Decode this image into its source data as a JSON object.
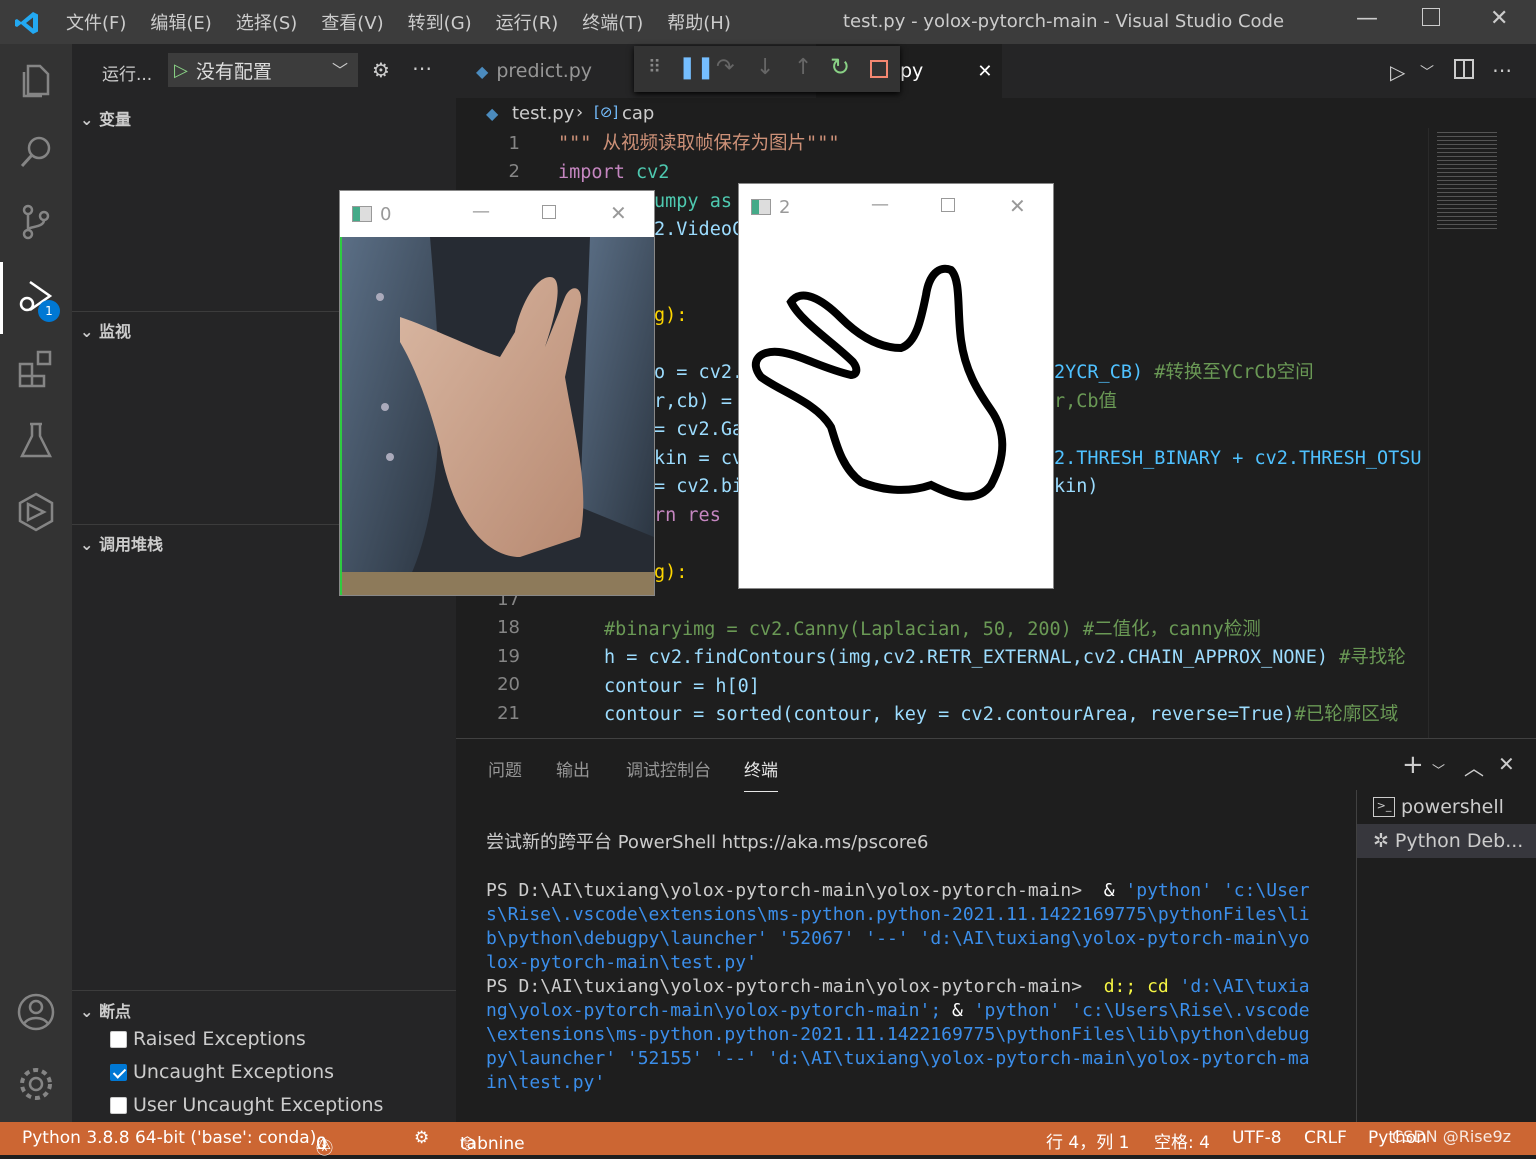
{
  "titlebar": {
    "menu": [
      "文件(F)",
      "编辑(E)",
      "选择(S)",
      "查看(V)",
      "转到(G)",
      "运行(R)",
      "终端(T)",
      "帮助(H)"
    ],
    "title": "test.py - yolox-pytorch-main - Visual Studio Code"
  },
  "activity": {
    "debug_badge": "1"
  },
  "sidebar": {
    "run_label": "运行...",
    "config_label": "没有配置",
    "sections": {
      "variables": "变量",
      "watch": "监视",
      "callstack": "调用堆栈",
      "breakpoints": "断点"
    },
    "breakpoints": [
      {
        "label": "Raised Exceptions",
        "checked": false
      },
      {
        "label": "Uncaught Exceptions",
        "checked": true
      },
      {
        "label": "User Uncaught Exceptions",
        "checked": false
      }
    ]
  },
  "tabs": {
    "predict": "predict.py",
    "test_tail": "py"
  },
  "breadcrumb": {
    "file": "test.py",
    "symbol": "cap"
  },
  "code": {
    "line_numbers": [
      "1",
      "2",
      "17",
      "18",
      "19",
      "20",
      "21"
    ],
    "l1": "\"\"\" 从视频读取帧保存为图片\"\"\"",
    "l2_kw": "import",
    "l2_mod": "cv2",
    "l3": "umpy as",
    "l4": "2.VideoC",
    "l7": "g):",
    "l9a": "o = cv2.",
    "l9b": "2YCR_CB)",
    "l9c": "#转换至YCrCb空间",
    "l10a": "r,cb) =",
    "l10b": "r,Cb值",
    "l11": "= cv2.Ga",
    "l12a": "kin = cv",
    "l12b": "2.THRESH_BINARY + cv2.THRESH_OTSU",
    "l13a": "= cv2.bi",
    "l13b": "kin)",
    "l14": "rn res",
    "l16": "g):",
    "l18": "#binaryimg = cv2.Canny(Laplacian, 50, 200) #二值化，canny检测",
    "l19a": "h = cv2.findContours(img,cv2.RETR_EXTERNAL,cv2.CHAIN_APPROX_NONE)",
    "l19b": "#寻找轮",
    "l20": "contour = h[0]",
    "l21a": "contour = sorted(contour, key = cv2.contourArea, reverse=True)",
    "l21b": "#已轮廓区域"
  },
  "panel": {
    "tabs": [
      "问题",
      "输出",
      "调试控制台",
      "终端"
    ],
    "active_tab": "终端",
    "terminals": [
      "powershell",
      "Python Deb..."
    ],
    "term_lines": {
      "t1": "尝试新的跨平台 PowerShell https://aka.ms/pscore6",
      "p1": "PS D:\\AI\\tuxiang\\yolox-pytorch-main\\yolox-pytorch-main>",
      "c1a": "&",
      "c1b": "'python' 'c:\\User",
      "c1c": "s\\Rise\\.vscode\\extensions\\ms-python.python-2021.11.1422169775\\pythonFiles\\li",
      "c1d": "b\\python\\debugpy\\launcher' '52067' '--' 'd:\\AI\\tuxiang\\yolox-pytorch-main\\yo",
      "c1e": "lox-pytorch-main\\test.py'",
      "p2": "PS D:\\AI\\tuxiang\\yolox-pytorch-main\\yolox-pytorch-main>",
      "c2a": "d:; cd",
      "c2b": "'d:\\AI\\tuxia",
      "c2c": "ng\\yolox-pytorch-main\\yolox-pytorch-main';",
      "c2d": "&",
      "c2e": "'python' 'c:\\Users\\Rise\\.vscode",
      "c2f": "\\extensions\\ms-python.python-2021.11.1422169775\\pythonFiles\\lib\\python\\debug",
      "c2g": "py\\launcher' '52155' '--' 'd:\\AI\\tuxiang\\yolox-pytorch-main\\yolox-pytorch-ma",
      "c2h": "in\\test.py'"
    }
  },
  "cvwindows": {
    "win0": "0",
    "win2": "2"
  },
  "status": {
    "python": "Python 3.8.8 64-bit ('base': conda)",
    "errors": "0",
    "warnings": "0",
    "tabnine": "tabnine",
    "position": "行 4，列 1",
    "spaces": "空格: 4",
    "encoding": "UTF-8",
    "eol": "CRLF",
    "lang": "Python",
    "watermark": "CSDN @Rise9z"
  },
  "colors": {
    "statusbar": "#cc6633",
    "accent": "#0078d4",
    "activity": "#333333"
  }
}
